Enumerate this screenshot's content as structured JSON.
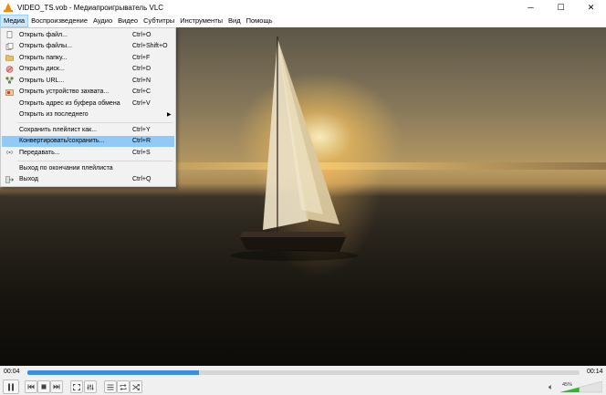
{
  "window": {
    "title": "VIDEO_TS.vob - Медиапроигрыватель VLC",
    "accent": "#f08a00"
  },
  "menubar": {
    "items": [
      "Медиа",
      "Воспроизведение",
      "Аудио",
      "Видео",
      "Субтитры",
      "Инструменты",
      "Вид",
      "Помощь"
    ]
  },
  "media_menu": {
    "items": [
      {
        "label": "Открыть файл...",
        "shortcut": "Ctrl+O",
        "icon": "file-icon"
      },
      {
        "label": "Открыть файлы...",
        "shortcut": "Ctrl+Shift+O",
        "icon": "files-icon"
      },
      {
        "label": "Открыть папку...",
        "shortcut": "Ctrl+F",
        "icon": "folder-icon"
      },
      {
        "label": "Открыть диск...",
        "shortcut": "Ctrl+D",
        "icon": "disc-icon"
      },
      {
        "label": "Открыть URL...",
        "shortcut": "Ctrl+N",
        "icon": "network-icon"
      },
      {
        "label": "Открыть устройство захвата...",
        "shortcut": "Ctrl+C",
        "icon": "capture-icon"
      },
      {
        "label": "Открыть адрес из буфера обмена",
        "shortcut": "Ctrl+V",
        "icon": ""
      },
      {
        "label": "Открыть из последнего",
        "shortcut": "",
        "icon": ""
      },
      {
        "label": "Сохранить плейлист как...",
        "shortcut": "Ctrl+Y",
        "icon": ""
      },
      {
        "label": "Конвертировать/сохранить...",
        "shortcut": "Ctrl+R",
        "icon": ""
      },
      {
        "label": "Передавать...",
        "shortcut": "Ctrl+S",
        "icon": "stream-icon"
      },
      {
        "label": "Выход по окончании плейлиста",
        "shortcut": "",
        "icon": ""
      },
      {
        "label": "Выход",
        "shortcut": "Ctrl+Q",
        "icon": "exit-icon"
      }
    ],
    "highlighted_index": 9,
    "highlight_color": "#91c9f7"
  },
  "player": {
    "time_elapsed": "00:04",
    "time_total": "00:14",
    "progress_fraction": 0.31,
    "volume_label": "45%",
    "volume_fraction": 0.45,
    "seek_color": "#3d8ee0",
    "volume_color": "#2fb72f"
  }
}
